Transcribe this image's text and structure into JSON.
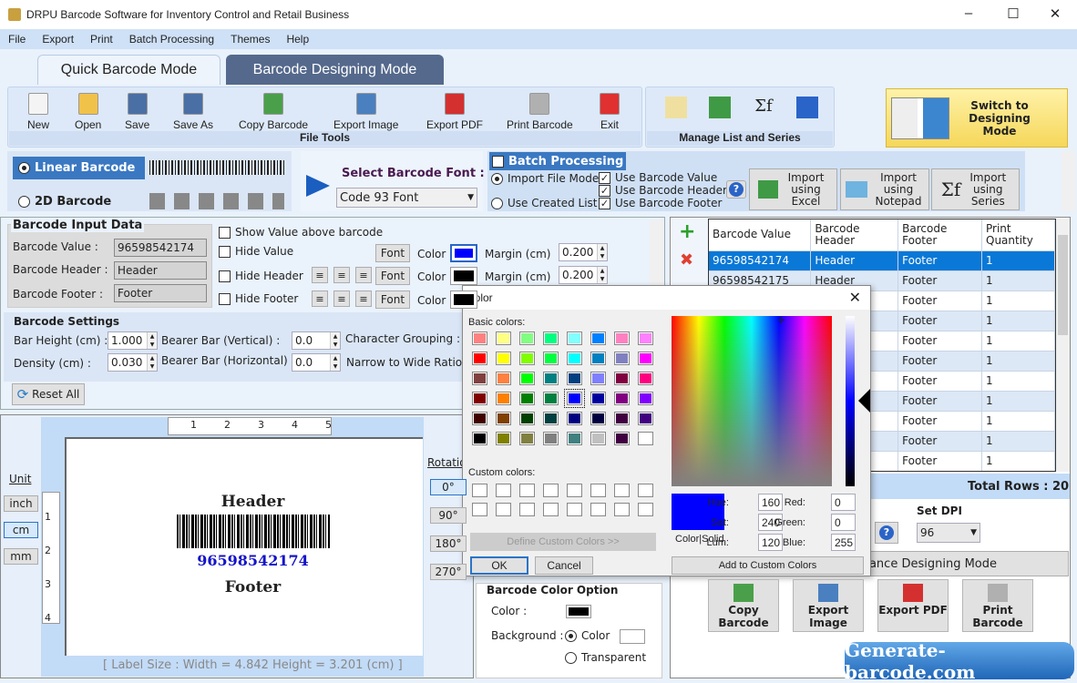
{
  "window": {
    "title": "DRPU Barcode Software for Inventory Control and Retail Business",
    "minimize": "–",
    "maximize": "☐",
    "close": "✕"
  },
  "menu": [
    "File",
    "Export",
    "Print",
    "Batch Processing",
    "Themes",
    "Help"
  ],
  "tabs": [
    {
      "label": "Quick Barcode Mode",
      "active": true
    },
    {
      "label": "Barcode Designing Mode",
      "active": false
    }
  ],
  "file_tools": {
    "label": "File Tools",
    "buttons": [
      {
        "label": "New",
        "icon": "new-file-icon",
        "color": "#f4f4f4"
      },
      {
        "label": "Open",
        "icon": "open-folder-icon",
        "color": "#f1c24a"
      },
      {
        "label": "Save",
        "icon": "save-icon",
        "color": "#4a6fa5"
      },
      {
        "label": "Save As",
        "icon": "save-as-icon",
        "color": "#4a6fa5"
      },
      {
        "label": "Copy Barcode",
        "icon": "copy-barcode-icon",
        "color": "#4aa04a"
      },
      {
        "label": "Export Image",
        "icon": "export-image-icon",
        "color": "#4a7fc0"
      },
      {
        "label": "Export PDF",
        "icon": "export-pdf-icon",
        "color": "#d43030"
      },
      {
        "label": "Print Barcode",
        "icon": "printer-icon",
        "color": "#b0b0b0"
      },
      {
        "label": "Exit",
        "icon": "exit-icon",
        "color": "#e03030"
      }
    ]
  },
  "manage": {
    "label": "Manage List and Series",
    "icons": [
      "edit-list-icon",
      "excel-icon",
      "series-formula-icon",
      "swap-icon"
    ]
  },
  "switch_button": "Switch to Designing Mode",
  "barcode_type": {
    "linear": "Linear Barcode",
    "twod": "2D Barcode",
    "selected": "linear"
  },
  "font_select": {
    "label": "Select Barcode Font :",
    "value": "Code 93 Font"
  },
  "batch": {
    "title": "Batch Processing",
    "checked": true,
    "import_file_mode": "Import File Mode",
    "use_created_list": "Use Created List",
    "mode_selected": "import_file_mode",
    "use_value": "Use Barcode Value",
    "use_header": "Use Barcode Header",
    "use_footer": "Use Barcode Footer",
    "import_excel": "Import using Excel",
    "import_notepad": "Import using Notepad",
    "import_series": "Import using Series"
  },
  "input_data": {
    "title": "Barcode Input Data",
    "value_label": "Barcode Value :",
    "value": "96598542174",
    "header_label": "Barcode Header :",
    "header": "Header",
    "footer_label": "Barcode Footer :",
    "footer": "Footer"
  },
  "options": {
    "show_above": "Show Value above barcode",
    "hide_value": "Hide Value",
    "hide_header": "Hide Header",
    "hide_footer": "Hide Footer",
    "font": "Font",
    "color": "Color",
    "margin": "Margin (cm)",
    "value_color": "#0000ff",
    "header_color": "#000000",
    "footer_color": "#000000",
    "value_margin": "0.200",
    "header_margin": "0.200"
  },
  "settings": {
    "title": "Barcode Settings",
    "bar_height_label": "Bar Height (cm) :",
    "bar_height": "1.000",
    "density_label": "Density (cm) :",
    "density": "0.030",
    "bearer_v_label": "Bearer Bar (Vertical) :",
    "bearer_v": "0.0",
    "bearer_h_label": "Bearer Bar (Horizontal) :",
    "bearer_h": "0.0",
    "char_group": "Character Grouping  :",
    "narrow_wide": "Narrow to Wide Ratio",
    "reset": "Reset All"
  },
  "preview": {
    "unit_label": "Unit",
    "units": [
      "inch",
      "cm",
      "mm"
    ],
    "selected_unit": "cm",
    "ruler_h": [
      "1",
      "2",
      "3",
      "4",
      "5"
    ],
    "ruler_v": [
      "1",
      "2",
      "3",
      "4"
    ],
    "header": "Header",
    "value": "96598542174",
    "footer": "Footer",
    "label_size": "[ Label Size : Width = 4.842  Height = 3.201 (cm) ]",
    "rotation_label": "Rotation",
    "rotations": [
      "0°",
      "90°",
      "180°",
      "270°"
    ],
    "selected_rotation": "0°"
  },
  "color_option": {
    "title": "Barcode Color Option",
    "color_label": "Color :",
    "bg_label": "Background :",
    "bg_color": "Color",
    "bg_transparent": "Transparent",
    "bar_color": "#000000",
    "bg_value": "#ffffff"
  },
  "table": {
    "columns": [
      "Barcode Value",
      "Barcode Header",
      "Barcode Footer",
      "Print Quantity"
    ],
    "rows": [
      [
        "96598542174",
        "Header",
        "Footer",
        "1"
      ],
      [
        "96598542175",
        "Header",
        "Footer",
        "1"
      ],
      [
        "",
        "",
        "Footer",
        "1"
      ],
      [
        "",
        "",
        "Footer",
        "1"
      ],
      [
        "",
        "",
        "Footer",
        "1"
      ],
      [
        "",
        "",
        "Footer",
        "1"
      ],
      [
        "",
        "",
        "Footer",
        "1"
      ],
      [
        "",
        "",
        "Footer",
        "1"
      ],
      [
        "",
        "",
        "Footer",
        "1"
      ],
      [
        "",
        "",
        "Footer",
        "1"
      ],
      [
        "",
        "",
        "Footer",
        "1"
      ]
    ],
    "total_rows": "Total Rows : 20",
    "selected_row": 0
  },
  "dpi": {
    "label": "Set DPI",
    "value": "96"
  },
  "advance": "Advance Designing Mode",
  "actions": [
    "Copy Barcode",
    "Export Image",
    "Export PDF",
    "Print Barcode"
  ],
  "watermark": "Generate-barcode.com",
  "color_dialog": {
    "title": "Color",
    "basic_label": "Basic colors:",
    "custom_label": "Custom colors:",
    "define": "Define Custom Colors >>",
    "ok": "OK",
    "cancel": "Cancel",
    "color_solid": "Color|Solid",
    "hue_label": "Hue:",
    "hue": "160",
    "sat_label": "Sat:",
    "sat": "240",
    "lum_label": "Lum:",
    "lum": "120",
    "red_label": "Red:",
    "red": "0",
    "green_label": "Green:",
    "green": "0",
    "blue_label": "Blue:",
    "blue": "255",
    "add_custom": "Add to Custom Colors",
    "selected": "#0000ff",
    "basic_colors": [
      "#ff8080",
      "#ffff80",
      "#80ff80",
      "#00ff80",
      "#80ffff",
      "#0080ff",
      "#ff80c0",
      "#ff80ff",
      "#ff0000",
      "#ffff00",
      "#80ff00",
      "#00ff40",
      "#00ffff",
      "#0080c0",
      "#8080c0",
      "#ff00ff",
      "#804040",
      "#ff8040",
      "#00ff00",
      "#008080",
      "#004080",
      "#8080ff",
      "#800040",
      "#ff0080",
      "#800000",
      "#ff8000",
      "#008000",
      "#008040",
      "#0000ff",
      "#0000a0",
      "#800080",
      "#8000ff",
      "#400000",
      "#804000",
      "#004000",
      "#004040",
      "#000080",
      "#000040",
      "#400040",
      "#400080",
      "#000000",
      "#808000",
      "#808040",
      "#808080",
      "#408080",
      "#c0c0c0",
      "#400040",
      "#ffffff"
    ]
  }
}
